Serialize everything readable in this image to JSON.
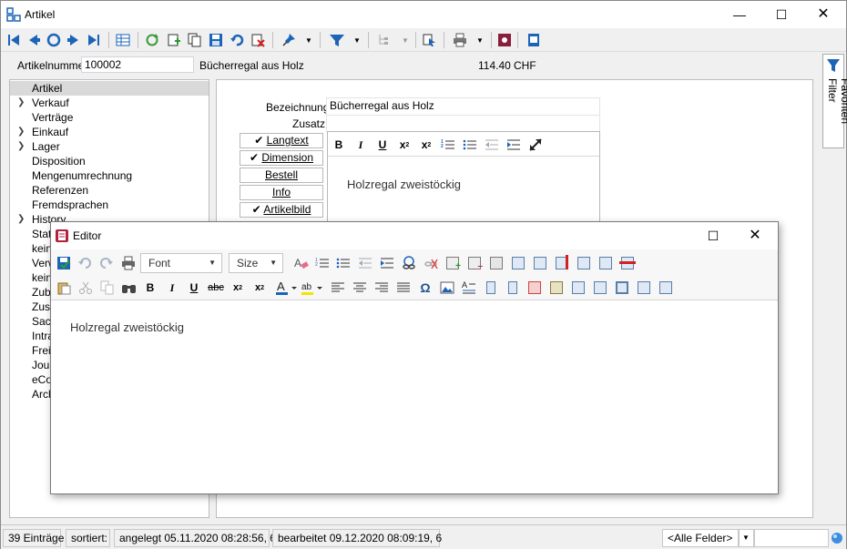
{
  "window": {
    "title": "Artikel"
  },
  "header": {
    "artikelnummer_label": "Artikelnummer",
    "artikelnummer_value": "100002",
    "name": "Bücherregal aus Holz",
    "price": "114.40",
    "currency": "CHF"
  },
  "tree": {
    "items": [
      {
        "label": "Artikel",
        "expandable": false,
        "selected": true
      },
      {
        "label": "Verkauf",
        "expandable": true
      },
      {
        "label": "Verträge",
        "expandable": false
      },
      {
        "label": "Einkauf",
        "expandable": true
      },
      {
        "label": "Lager",
        "expandable": true
      },
      {
        "label": "Disposition",
        "expandable": false
      },
      {
        "label": "Mengenumrechnung",
        "expandable": false
      },
      {
        "label": "Referenzen",
        "expandable": false
      },
      {
        "label": "Fremdsprachen",
        "expandable": false
      },
      {
        "label": "History",
        "expandable": true
      },
      {
        "label": "Stati",
        "expandable": false
      },
      {
        "label": "kein",
        "expandable": false
      },
      {
        "label": "Verw",
        "expandable": false
      },
      {
        "label": "kein",
        "expandable": false
      },
      {
        "label": "Zube",
        "expandable": false
      },
      {
        "label": "Zusa",
        "expandable": false
      },
      {
        "label": "Sach",
        "expandable": false
      },
      {
        "label": "Intra",
        "expandable": false
      },
      {
        "label": "Freie",
        "expandable": false
      },
      {
        "label": "Jour",
        "expandable": false
      },
      {
        "label": "eCor",
        "expandable": false
      },
      {
        "label": "Arch",
        "expandable": false
      }
    ]
  },
  "form": {
    "bezeichnung_label": "Bezeichnung",
    "bezeichnung_value": "Bücherregal aus Holz",
    "zusatz_label": "Zusatz",
    "zusatz_value": ""
  },
  "side_buttons": [
    {
      "label": "Langtext",
      "checked": true
    },
    {
      "label": "Dimension",
      "checked": true
    },
    {
      "label": "Bestell",
      "checked": false
    },
    {
      "label": "Info",
      "checked": false
    },
    {
      "label": "Artikelbild",
      "checked": true
    }
  ],
  "inline_editor": {
    "content": "Holzregal zweistöckig"
  },
  "favorites_tab": {
    "label": "Favoriten Filter"
  },
  "editor_dialog": {
    "title": "Editor",
    "font_combo": "Font",
    "size_combo": "Size",
    "content": "Holzregal zweistöckig"
  },
  "status": {
    "count": "39 Einträge",
    "sorted": "sortiert:",
    "created": "angelegt 05.11.2020 08:28:56,  6",
    "edited": "bearbeitet 09.12.2020 08:09:19,  6",
    "field_filter": "<Alle Felder>"
  },
  "colors": {
    "accent_blue": "#1d64b8",
    "toolbar_bg": "#f0f0f0"
  }
}
